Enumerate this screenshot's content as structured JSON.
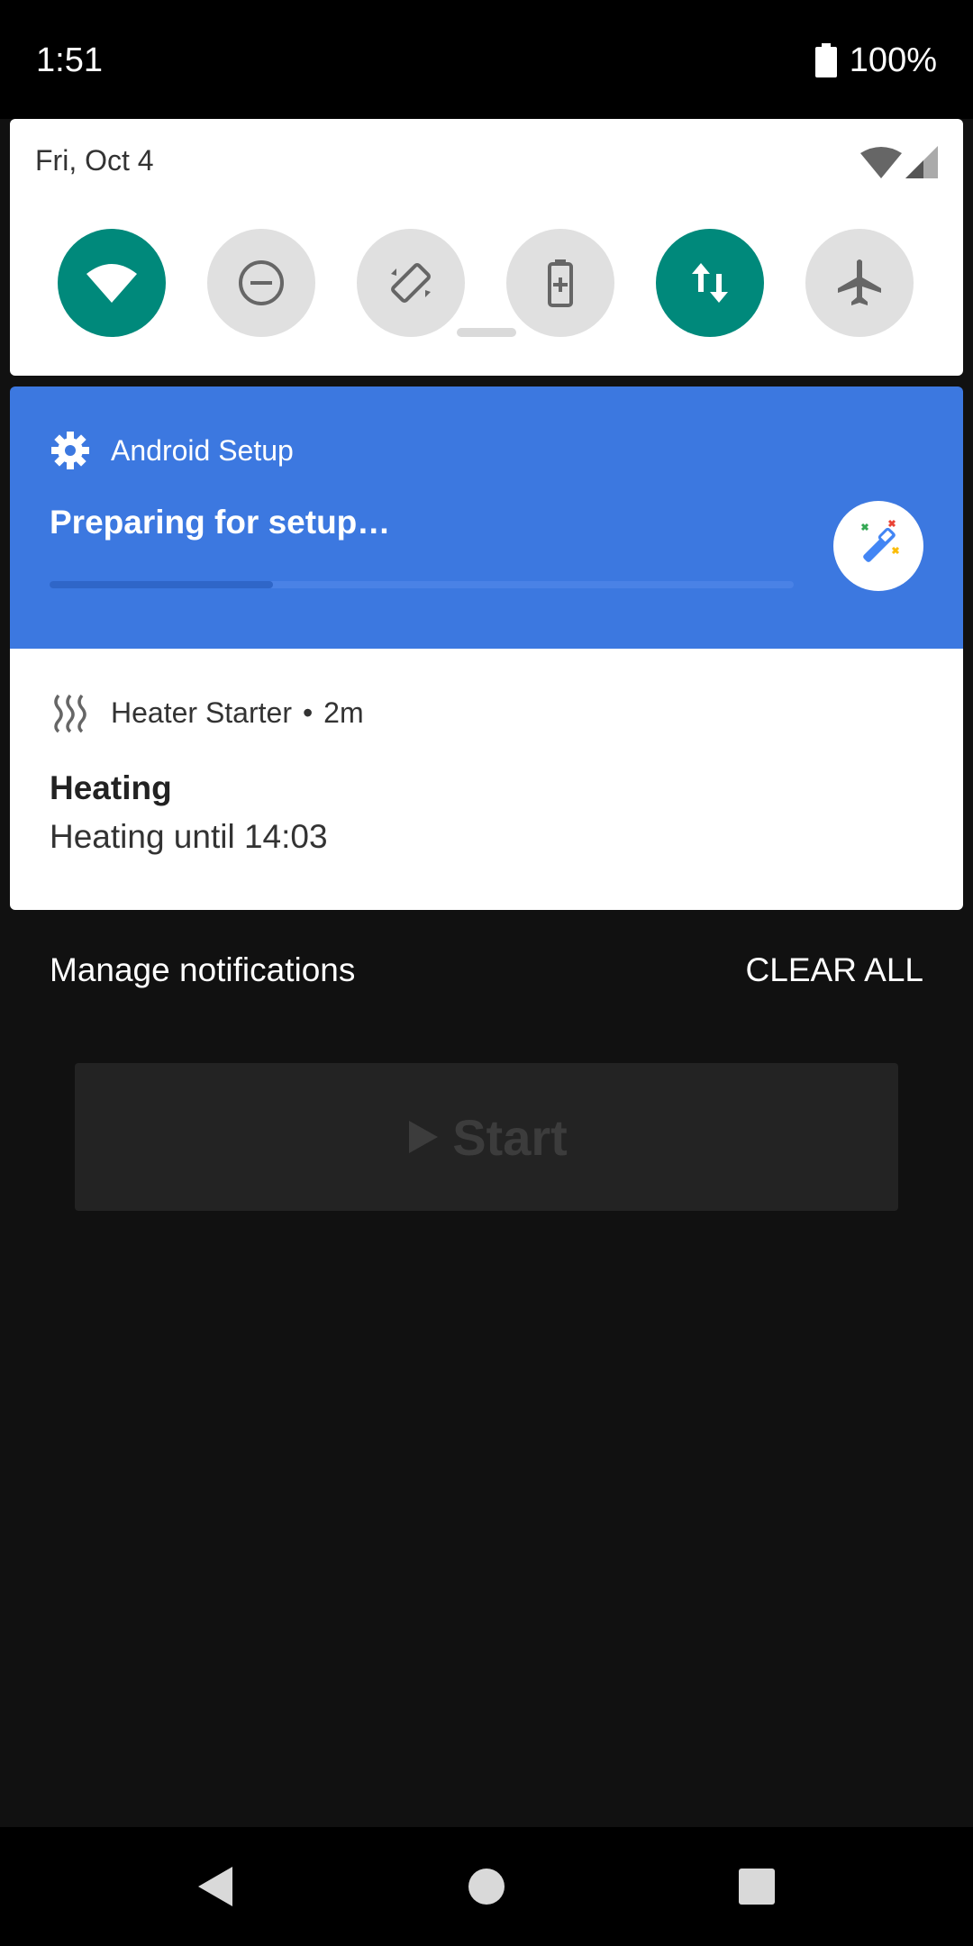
{
  "status_bar": {
    "time": "1:51",
    "battery": "100%"
  },
  "quick_settings": {
    "date": "Fri, Oct 4",
    "tiles": [
      {
        "name": "wifi",
        "active": true
      },
      {
        "name": "do-not-disturb",
        "active": false
      },
      {
        "name": "auto-rotate",
        "active": false
      },
      {
        "name": "battery-saver",
        "active": false
      },
      {
        "name": "mobile-data",
        "active": true
      },
      {
        "name": "airplane-mode",
        "active": false
      }
    ]
  },
  "notifications": {
    "setup": {
      "app": "Android Setup",
      "title": "Preparing for setup…",
      "progress": 0.3
    },
    "heater": {
      "app": "Heater Starter",
      "time": "2m",
      "title": "Heating",
      "text": "Heating until 14:03"
    }
  },
  "actions": {
    "manage": "Manage notifications",
    "clear_all": "CLEAR ALL"
  },
  "background_app": {
    "start_label": "Start"
  },
  "colors": {
    "accent": "#00897b",
    "setup_bg": "#3c78e0"
  }
}
